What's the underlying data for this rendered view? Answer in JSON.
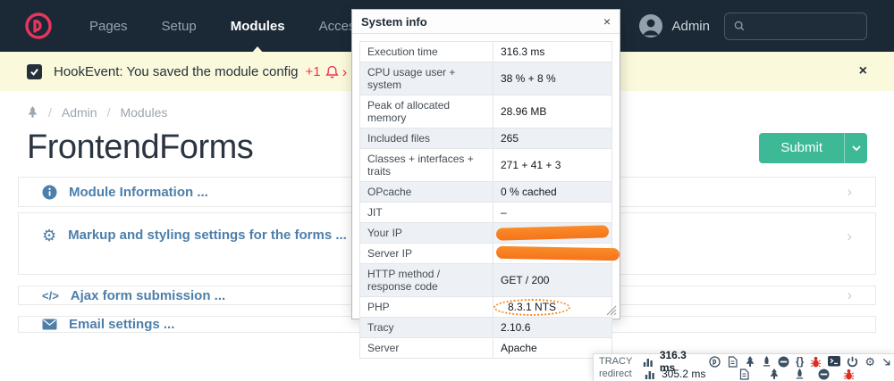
{
  "navbar": {
    "items": [
      {
        "label": "Pages"
      },
      {
        "label": "Setup"
      },
      {
        "label": "Modules"
      },
      {
        "label": "Access"
      }
    ],
    "user": "Admin"
  },
  "notification": {
    "message": "HookEvent: You saved the module config",
    "count": "+1"
  },
  "breadcrumb": {
    "items": [
      "Admin",
      "Modules"
    ]
  },
  "page": {
    "title": "FrontendForms",
    "submit_label": "Submit"
  },
  "sections": [
    {
      "icon": "info-icon",
      "label": "Module Information ..."
    },
    {
      "icon": "gear-icon",
      "label": "Markup and styling settings for the forms ..."
    },
    {
      "icon": "code-icon",
      "label": "Ajax form submission ..."
    },
    {
      "icon": "email-icon",
      "label": "Email settings ..."
    }
  ],
  "system_info": {
    "title": "System info",
    "rows": [
      {
        "label": "Execution time",
        "value": "316.3 ms"
      },
      {
        "label": "CPU usage user + system",
        "value": "38 % + 8 %"
      },
      {
        "label": "Peak of allocated memory",
        "value": "28.96 MB"
      },
      {
        "label": "Included files",
        "value": "265"
      },
      {
        "label": "Classes + interfaces + traits",
        "value": "271 + 41 + 3"
      },
      {
        "label": "OPcache",
        "value": "0 % cached"
      },
      {
        "label": "JIT",
        "value": "–"
      },
      {
        "label": "Your IP",
        "value": "",
        "redacted": true
      },
      {
        "label": "Server IP",
        "value": "",
        "redacted": true
      },
      {
        "label": "HTTP method / response code",
        "value": "GET / 200"
      },
      {
        "label": "PHP",
        "value": "8.3.1 NTS",
        "circled": true
      },
      {
        "label": "Tracy",
        "value": "2.10.6"
      },
      {
        "label": "Server",
        "value": "Apache"
      }
    ]
  },
  "tracy_bar": {
    "rows": [
      {
        "label": "TRACY",
        "time": "316.3 ms"
      },
      {
        "label": "redirect",
        "time": "305.2 ms"
      }
    ]
  },
  "icons": {
    "chevron_right": "›",
    "close_x": "×",
    "braces": "{}",
    "code": "</>",
    "gear": "⚙"
  },
  "colors": {
    "navy": "#1b2936",
    "pink": "#e8355f",
    "yellow": "#fbf9dc",
    "blue": "#4d7fab",
    "green": "#3eb998",
    "orange": "#f5741a",
    "bug_red": "#d93025"
  }
}
